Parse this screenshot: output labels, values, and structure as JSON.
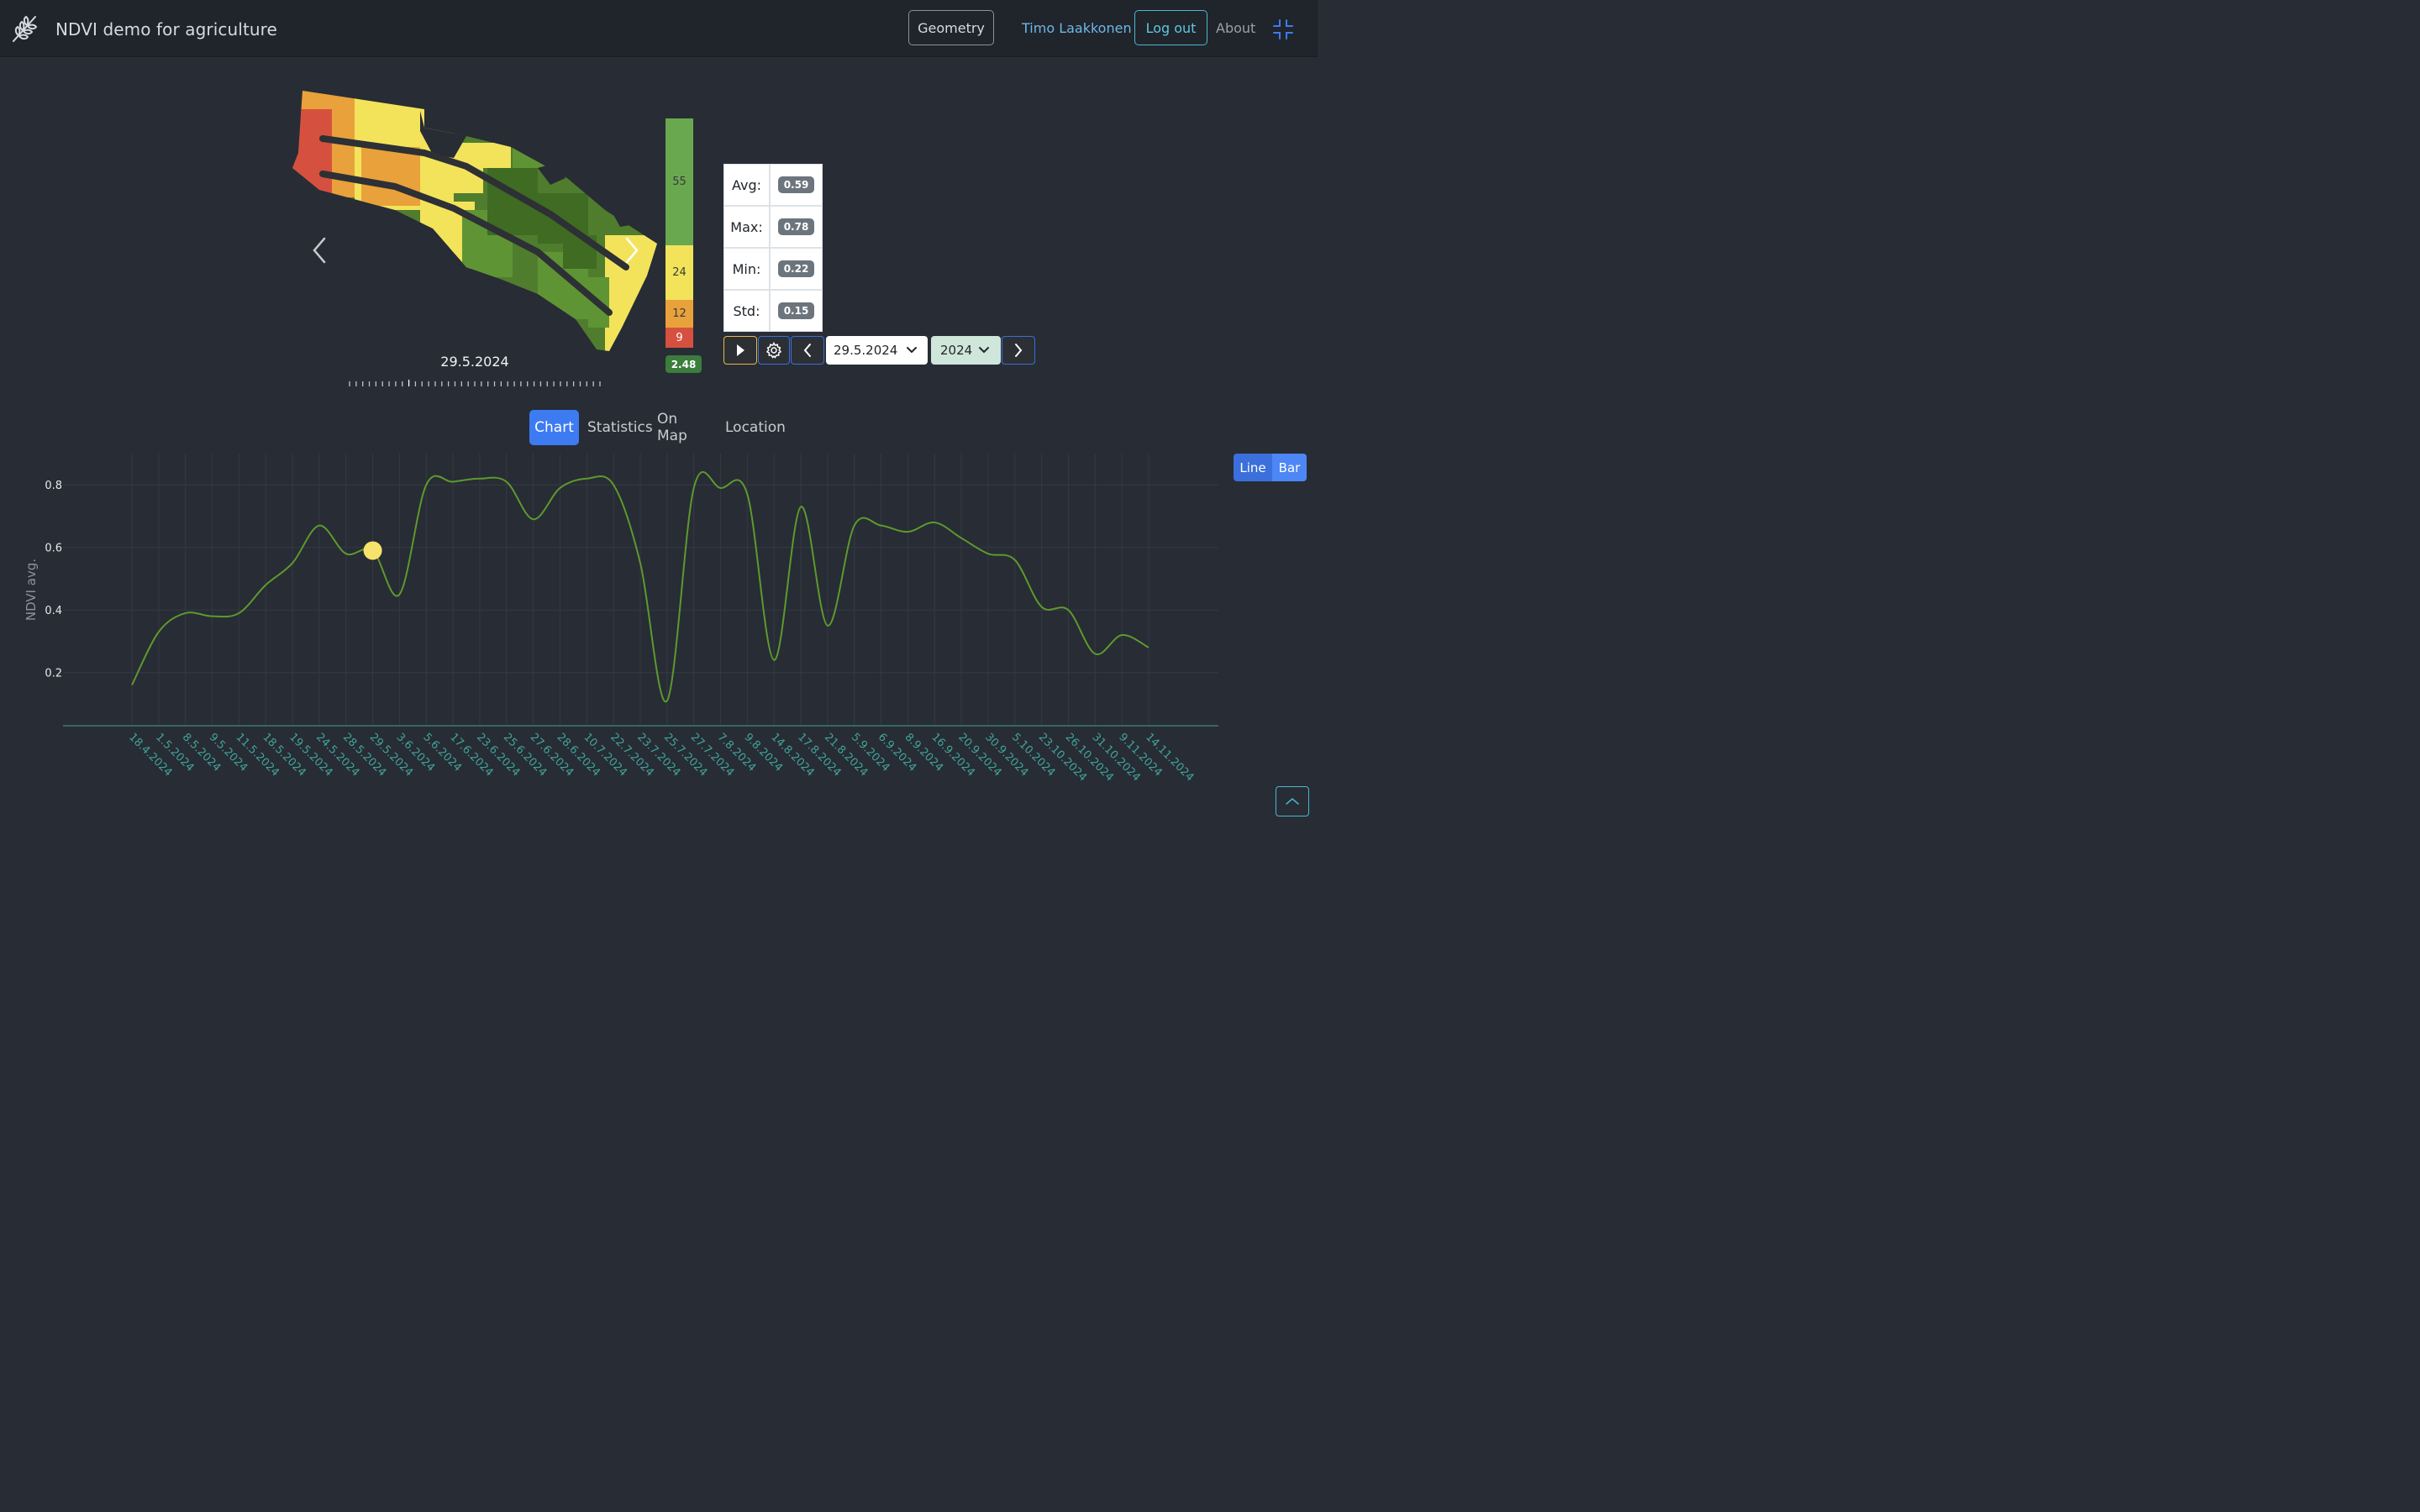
{
  "app": {
    "title": "NDVI demo for agriculture"
  },
  "navbar": {
    "geometry_label": "Geometry",
    "user_name": "Timo Laakkonen",
    "logout_label": "Log out",
    "about_label": "About"
  },
  "map": {
    "date": "29.5.2024"
  },
  "legend": {
    "segments": [
      {
        "count": "55",
        "color": "#6aa84f"
      },
      {
        "count": "24",
        "color": "#f2e35a"
      },
      {
        "count": "12",
        "color": "#e9a13b"
      },
      {
        "count": "9",
        "color": "#d6503f"
      }
    ],
    "total": "2.48"
  },
  "stats": {
    "avg_label": "Avg:",
    "avg": "0.59",
    "max_label": "Max:",
    "max": "0.78",
    "min_label": "Min:",
    "min": "0.22",
    "std_label": "Std:",
    "std": "0.15"
  },
  "controls": {
    "date_value": "29.5.2024",
    "year_value": "2024"
  },
  "tabs": [
    "Chart",
    "Statistics",
    "On Map",
    "Location"
  ],
  "chart_toggle": {
    "line_label": "Line",
    "bar_label": "Bar"
  },
  "chart_data": {
    "type": "line",
    "ylabel": "NDVI avg.",
    "ylim": [
      0.03,
      0.9
    ],
    "yticks": [
      "0.8",
      "0.6",
      "0.4",
      "0.2"
    ],
    "ytick_values": [
      0.8,
      0.6,
      0.4,
      0.2
    ],
    "categories": [
      "18.4.2024",
      "1.5.2024",
      "8.5.2024",
      "9.5.2024",
      "11.5.2024",
      "18.5.2024",
      "19.5.2024",
      "24.5.2024",
      "28.5.2024",
      "29.5.2024",
      "3.6.2024",
      "5.6.2024",
      "17.6.2024",
      "23.6.2024",
      "25.6.2024",
      "27.6.2024",
      "28.6.2024",
      "10.7.2024",
      "22.7.2024",
      "23.7.2024",
      "25.7.2024",
      "27.7.2024",
      "7.8.2024",
      "9.8.2024",
      "14.8.2024",
      "17.8.2024",
      "21.8.2024",
      "5.9.2024",
      "6.9.2024",
      "8.9.2024",
      "16.9.2024",
      "20.9.2024",
      "30.9.2024",
      "5.10.2024",
      "23.10.2024",
      "26.10.2024",
      "31.10.2024",
      "9.11.2024",
      "14.11.2024"
    ],
    "values": [
      0.16,
      0.33,
      0.39,
      0.38,
      0.39,
      0.48,
      0.55,
      0.67,
      0.58,
      0.59,
      0.45,
      0.8,
      0.81,
      0.82,
      0.81,
      0.69,
      0.79,
      0.82,
      0.8,
      0.55,
      0.11,
      0.79,
      0.79,
      0.77,
      0.24,
      0.73,
      0.35,
      0.67,
      0.67,
      0.65,
      0.68,
      0.63,
      0.58,
      0.56,
      0.41,
      0.4,
      0.26,
      0.32,
      0.28
    ],
    "highlight_index": 9,
    "line_color": "#5c9a2c",
    "highlight_color": "#f7e26b",
    "tick_color": "#3fa59a"
  }
}
